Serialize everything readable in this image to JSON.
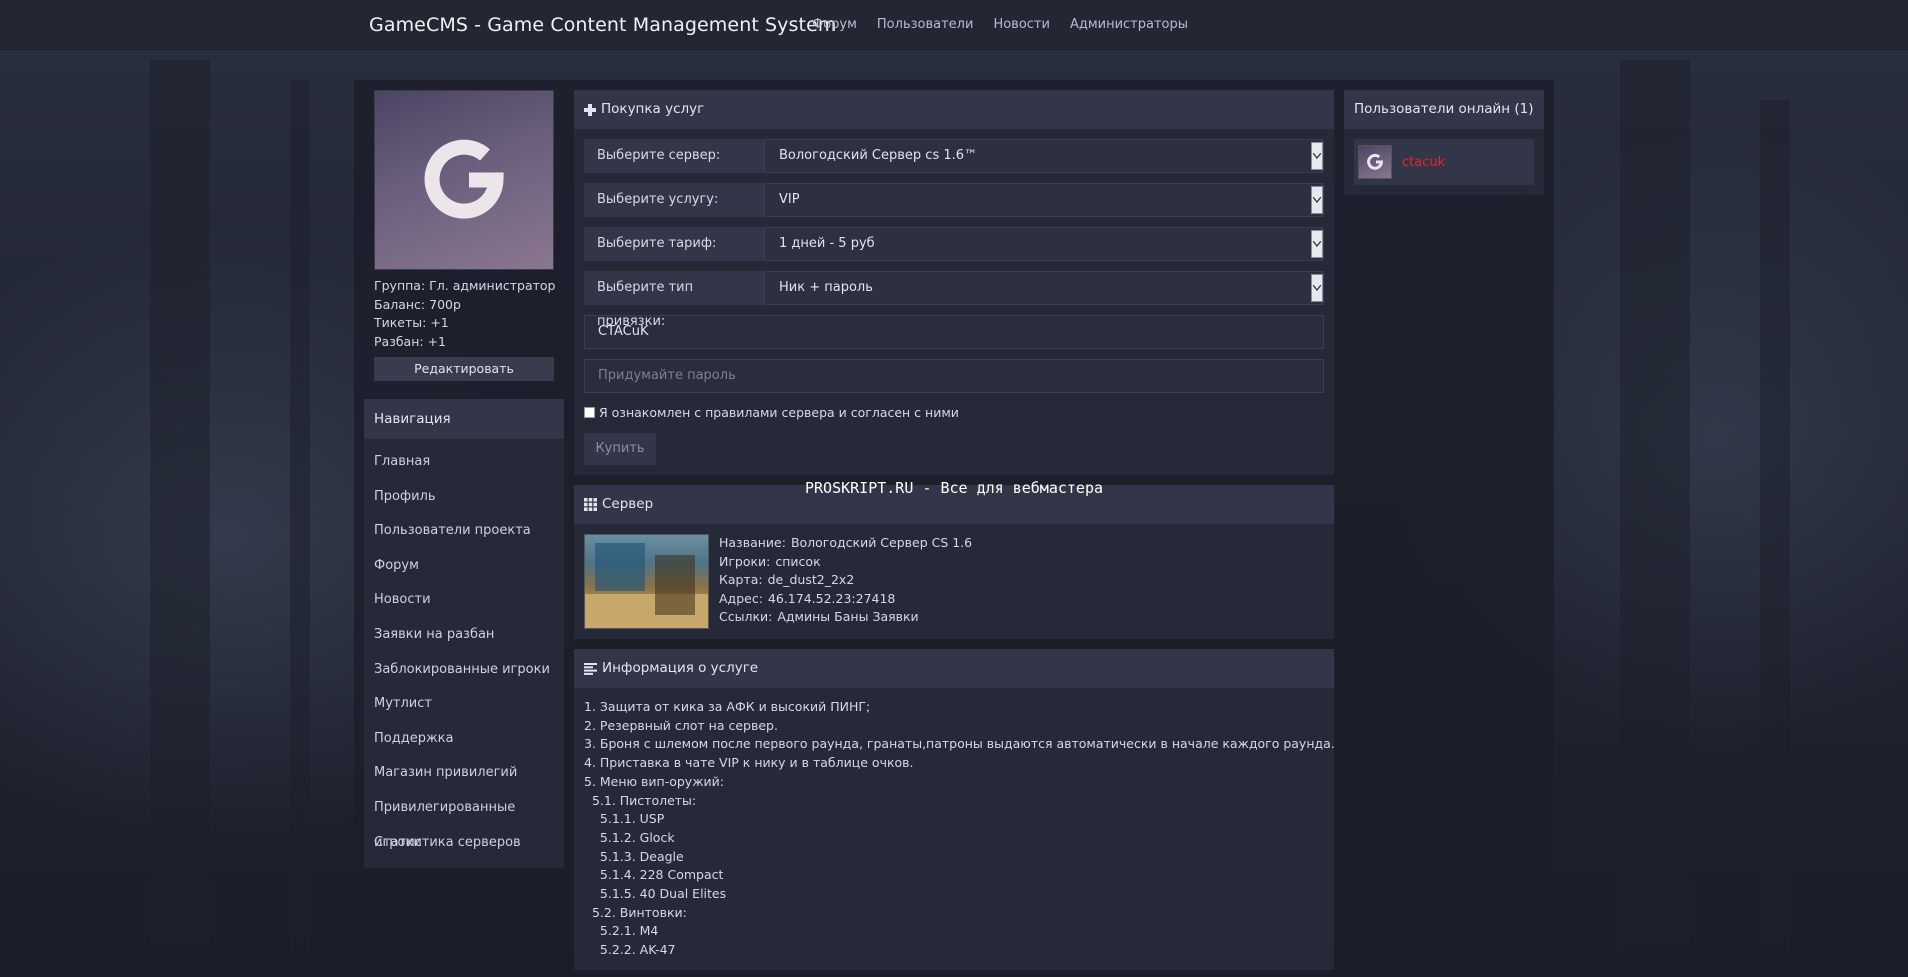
{
  "header": {
    "brand": "GameCMS - Game Content Management System",
    "nav": [
      "Форум",
      "Пользователи",
      "Новости",
      "Администраторы"
    ]
  },
  "profile": {
    "group": "Группа: Гл. администратор",
    "balance": "Баланс: 700р",
    "tickets": "Тикеты: +1",
    "unban": "Разбан: +1",
    "edit_label": "Редактировать"
  },
  "navigation": {
    "title": "Навигация",
    "items": [
      "Главная",
      "Профиль",
      "Пользователи проекта",
      "Форум",
      "Новости",
      "Заявки на разбан",
      "Заблокированные игроки",
      "Мутлист",
      "Поддержка",
      "Магазин привилегий",
      "Привилегированные игроки",
      "Статистика серверов"
    ]
  },
  "purchase": {
    "title": "Покупка услуг",
    "fields": [
      {
        "label": "Выберите сервер:",
        "value": "Вологодский Сервер cs 1.6™"
      },
      {
        "label": "Выберите услугу:",
        "value": "VIP"
      },
      {
        "label": "Выберите тариф:",
        "value": "1 дней - 5 руб"
      },
      {
        "label": "Выберите тип привязки:",
        "value": "Ник + пароль"
      }
    ],
    "nick_value": "CTACuK",
    "password_placeholder": "Придумайте пароль",
    "agree_text": "Я ознакомлен с правилами сервера и согласен с ними",
    "buy_label": "Купить"
  },
  "watermark": "PROSKRIPT.RU - Все для вебмастера",
  "server": {
    "title": "Сервер",
    "name_key": "Название:",
    "name": "Вологодский Сервер CS 1.6",
    "players_key": "Игроки:",
    "players": "список",
    "map_key": "Карта:",
    "map": "de_dust2_2x2",
    "address_key": "Адрес:",
    "address": "46.174.52.23:27418",
    "links_key": "Ссылки:",
    "links": [
      "Админы",
      "Баны",
      "Заявки"
    ]
  },
  "service_info": {
    "title": "Информация о услуге",
    "lines": [
      "1. Защита от кика за АФК и высокий ПИНГ;",
      "2. Резервный слот на сервер.",
      "3. Броня с шлемом после первого раунда, гранаты,патроны выдаются автоматически в начале каждого раунда.",
      "4. Приставка в чате VIP к нику и в таблице очков.",
      "5. Меню вип-оружий:",
      "  5.1. Пистолеты:",
      "    5.1.1. USP",
      "    5.1.2. Glock",
      "    5.1.3. Deagle",
      "    5.1.4. 228 Compact",
      "    5.1.5. 40 Dual Elites",
      "  5.2. Винтовки:",
      "    5.2.1. M4",
      "    5.2.2. AK-47"
    ]
  },
  "online": {
    "title": "Пользователи онлайн (1)",
    "users": [
      "ctacuk"
    ]
  },
  "colors": {
    "accent_user": "#e0262b",
    "panel_head": "#333648",
    "panel_body": "#262938"
  }
}
